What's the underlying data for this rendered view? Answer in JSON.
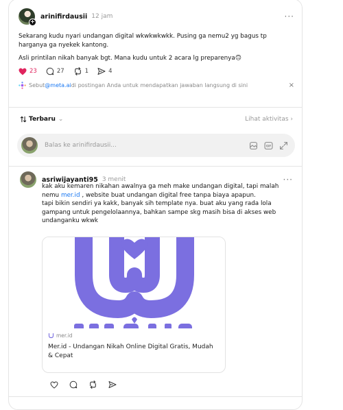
{
  "post": {
    "username": "arinifirdausii",
    "time": "12 jam",
    "more": "···",
    "text1": "Sekarang kudu nyari undangan digital wkwkwkwkk. Pusing ga nemu2 yg bagus tp harganya ga nyekek kantong.",
    "text2": "Asli printilan nikah banyak bgt. Mana kudu untuk 2 acara lg preparenya🙃",
    "likes": "23",
    "replies": "27",
    "reposts": "1",
    "shares": "4"
  },
  "meta_hint": {
    "prefix": "Sebut ",
    "link": "@meta.ai",
    "suffix": " di postingan Anda untuk mendapatkan jawaban langsung di sini",
    "close": "×"
  },
  "sort": {
    "label": "Terbaru",
    "chevron": "⌄",
    "activity": "Lihat aktivitas ›"
  },
  "reply_box": {
    "placeholder": "Balas ke arinifirdausii..."
  },
  "comment": {
    "username": "asriwijayanti95",
    "time": "3 menit",
    "more": "···",
    "text_a": "kak aku kemaren nikahan awalnya ga meh make undangan digital, tapi malah nemu ",
    "link": "mer.id",
    "text_b": " , website buat undangan digital free tanpa biaya apapun.",
    "text_c": "tapi bikin sendiri ya kakk, banyak sih template nya. buat aku yang rada lola gampang untuk pengelolaannya, bahkan sampe skg masih bisa di akses web undanganku wkwk"
  },
  "link_card": {
    "site": "mer.id",
    "title": "Mer.id - Undangan Nikah Online Digital Gratis, Mudah & Cepat",
    "image_text": "merid"
  },
  "colors": {
    "heart": "#e0245e",
    "link": "#1877f2",
    "brand_purple": "#7b6fe0"
  }
}
